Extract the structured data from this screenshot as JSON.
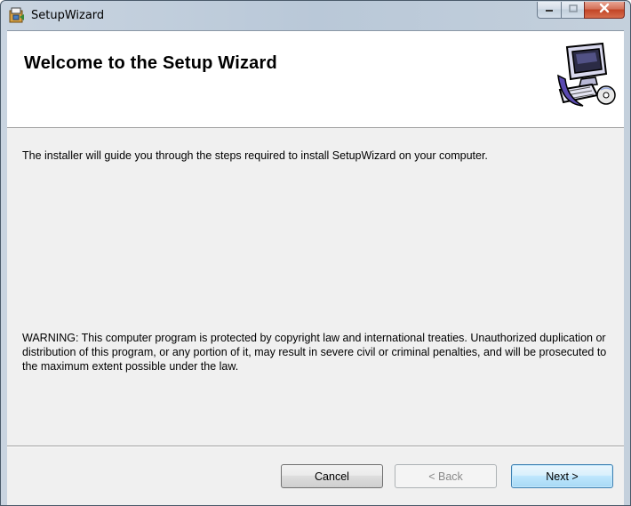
{
  "window": {
    "title": "SetupWizard",
    "icons": {
      "app": "installer-icon",
      "minimize": "minimize-icon",
      "maximize": "maximize-icon",
      "close": "close-icon"
    }
  },
  "header": {
    "title": "Welcome to the Setup Wizard",
    "art": "computer-setup-icon"
  },
  "body": {
    "intro": "The installer will guide you through the steps required to install SetupWizard on your computer.",
    "warning": "WARNING: This computer program is protected by copyright law and international treaties. Unauthorized duplication or distribution of this program, or any portion of it, may result in severe civil or criminal penalties, and will be prosecuted to the maximum extent possible under the law."
  },
  "buttons": {
    "cancel": "Cancel",
    "back": "< Back",
    "next": "Next >"
  },
  "colors": {
    "close_button": "#c24426",
    "default_button_border": "#3c7fb1",
    "dialog_background": "#f0f0f0"
  }
}
